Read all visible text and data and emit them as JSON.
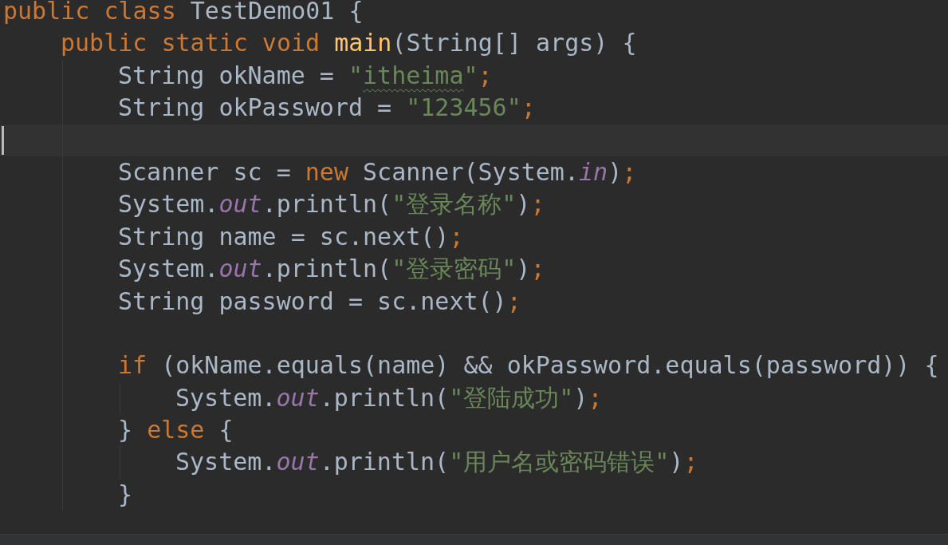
{
  "editor": {
    "lines": [
      {
        "current": false,
        "tokens": [
          {
            "kind": "keyword",
            "text": "public class "
          },
          {
            "kind": "plain",
            "text": "TestDemo01 {"
          }
        ],
        "children": [
          {
            "current": false,
            "tokens": [
              {
                "kind": "keyword",
                "text": "public static void "
              },
              {
                "kind": "method",
                "text": "main"
              },
              {
                "kind": "plain",
                "text": "(String[] args) {"
              }
            ],
            "children": [
              {
                "current": false,
                "tokens": [
                  {
                    "kind": "plain",
                    "text": "String okName = "
                  },
                  {
                    "kind": "string",
                    "text": "\""
                  },
                  {
                    "kind": "string",
                    "text": "itheima",
                    "typo": true
                  },
                  {
                    "kind": "string",
                    "text": "\""
                  },
                  {
                    "kind": "keyword",
                    "text": ";"
                  }
                ]
              },
              {
                "current": false,
                "tokens": [
                  {
                    "kind": "plain",
                    "text": "String okPassword = "
                  },
                  {
                    "kind": "string",
                    "text": "\"123456\""
                  },
                  {
                    "kind": "keyword",
                    "text": ";"
                  }
                ]
              },
              {
                "current": true
              },
              {
                "current": false,
                "tokens": [
                  {
                    "kind": "plain",
                    "text": "Scanner sc = "
                  },
                  {
                    "kind": "keyword",
                    "text": "new "
                  },
                  {
                    "kind": "plain",
                    "text": "Scanner(System."
                  },
                  {
                    "kind": "field",
                    "text": "in"
                  },
                  {
                    "kind": "plain",
                    "text": ")"
                  },
                  {
                    "kind": "keyword",
                    "text": ";"
                  }
                ]
              },
              {
                "current": false,
                "tokens": [
                  {
                    "kind": "plain",
                    "text": "System."
                  },
                  {
                    "kind": "field",
                    "text": "out"
                  },
                  {
                    "kind": "plain",
                    "text": ".println("
                  },
                  {
                    "kind": "string",
                    "text": "\"登录名称\""
                  },
                  {
                    "kind": "plain",
                    "text": ")"
                  },
                  {
                    "kind": "keyword",
                    "text": ";"
                  }
                ]
              },
              {
                "current": false,
                "tokens": [
                  {
                    "kind": "plain",
                    "text": "String name = sc.next()"
                  },
                  {
                    "kind": "keyword",
                    "text": ";"
                  }
                ]
              },
              {
                "current": false,
                "tokens": [
                  {
                    "kind": "plain",
                    "text": "System."
                  },
                  {
                    "kind": "field",
                    "text": "out"
                  },
                  {
                    "kind": "plain",
                    "text": ".println("
                  },
                  {
                    "kind": "string",
                    "text": "\"登录密码\""
                  },
                  {
                    "kind": "plain",
                    "text": ")"
                  },
                  {
                    "kind": "keyword",
                    "text": ";"
                  }
                ]
              },
              {
                "current": false,
                "tokens": [
                  {
                    "kind": "plain",
                    "text": "String password = sc.next()"
                  },
                  {
                    "kind": "keyword",
                    "text": ";"
                  }
                ]
              },
              {
                "current": false
              },
              {
                "current": false,
                "tokens": [
                  {
                    "kind": "keyword",
                    "text": "if "
                  },
                  {
                    "kind": "plain",
                    "text": "(okName.equals(name) && okPassword.equals(password)) {"
                  }
                ],
                "children": [
                  {
                    "current": false,
                    "tokens": [
                      {
                        "kind": "plain",
                        "text": "System."
                      },
                      {
                        "kind": "field",
                        "text": "out"
                      },
                      {
                        "kind": "plain",
                        "text": ".println("
                      },
                      {
                        "kind": "string",
                        "text": "\"登陆成功\""
                      },
                      {
                        "kind": "plain",
                        "text": ")"
                      },
                      {
                        "kind": "keyword",
                        "text": ";"
                      }
                    ]
                  }
                ]
              },
              {
                "current": false,
                "tokens": [
                  {
                    "kind": "plain",
                    "text": "} "
                  },
                  {
                    "kind": "keyword",
                    "text": "else "
                  },
                  {
                    "kind": "plain",
                    "text": "{"
                  }
                ],
                "children": [
                  {
                    "current": false,
                    "tokens": [
                      {
                        "kind": "plain",
                        "text": "System."
                      },
                      {
                        "kind": "field",
                        "text": "out"
                      },
                      {
                        "kind": "plain",
                        "text": ".println("
                      },
                      {
                        "kind": "string",
                        "text": "\"用户名或密码错误\""
                      },
                      {
                        "kind": "plain",
                        "text": ")"
                      },
                      {
                        "kind": "keyword",
                        "text": ";"
                      }
                    ]
                  }
                ]
              },
              {
                "current": false,
                "tokens": [
                  {
                    "kind": "plain",
                    "text": "}"
                  }
                ]
              }
            ]
          }
        ]
      }
    ]
  }
}
